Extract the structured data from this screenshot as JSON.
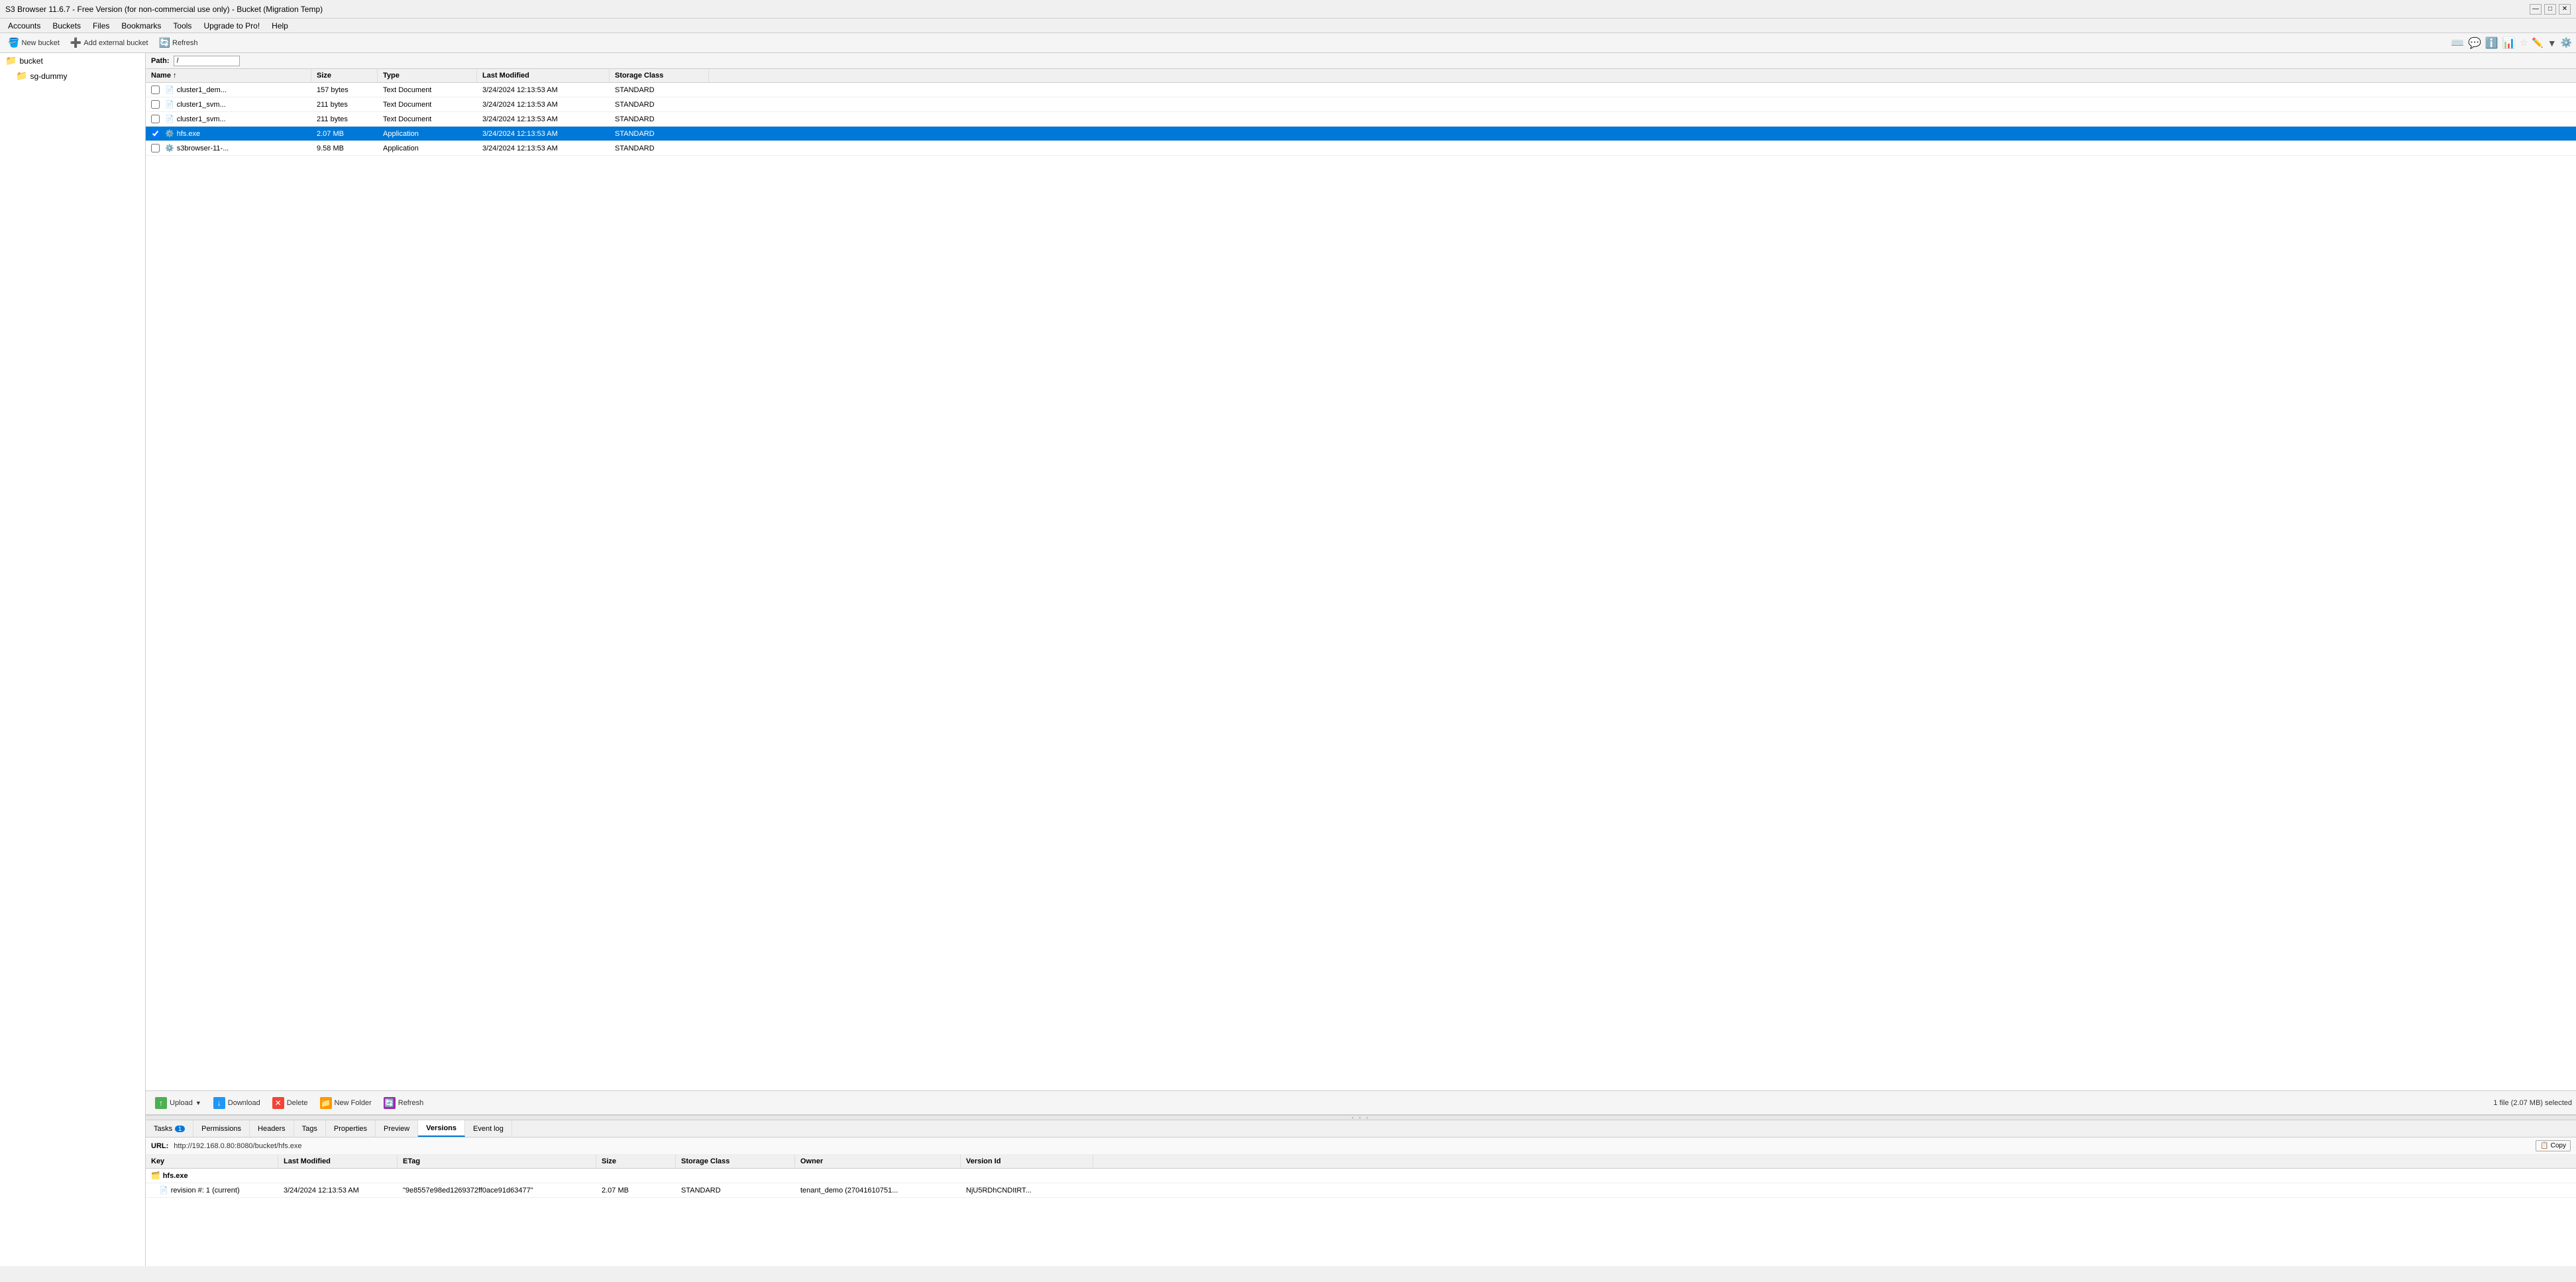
{
  "window": {
    "title": "S3 Browser 11.6.7 - Free Version (for non-commercial use only) - Bucket (Migration Temp)"
  },
  "title_bar": {
    "title": "S3 Browser 11.6.7 - Free Version (for non-commercial use only) - Bucket (Migration Temp)",
    "minimize": "—",
    "maximize": "□",
    "close": "✕"
  },
  "menu": {
    "items": [
      "Accounts",
      "Buckets",
      "Files",
      "Bookmarks",
      "Tools",
      "Upgrade to Pro!",
      "Help"
    ]
  },
  "toolbar": {
    "new_bucket": "New bucket",
    "add_external": "Add external bucket",
    "refresh": "Refresh"
  },
  "path_bar": {
    "label": "Path:",
    "value": "/"
  },
  "left_panel": {
    "items": [
      {
        "name": "bucket",
        "type": "folder",
        "indent": 0
      },
      {
        "name": "sg-dummy",
        "type": "folder",
        "indent": 1
      }
    ]
  },
  "file_list": {
    "columns": [
      "Name",
      "Size",
      "Type",
      "Last Modified",
      "Storage Class"
    ],
    "rows": [
      {
        "name": "cluster1_dem...",
        "size": "157 bytes",
        "type": "Text Document",
        "modified": "3/24/2024 12:13:53 AM",
        "storage": "STANDARD",
        "selected": false,
        "icon": "📄"
      },
      {
        "name": "cluster1_svm...",
        "size": "211 bytes",
        "type": "Text Document",
        "modified": "3/24/2024 12:13:53 AM",
        "storage": "STANDARD",
        "selected": false,
        "icon": "📄"
      },
      {
        "name": "cluster1_svm...",
        "size": "211 bytes",
        "type": "Text Document",
        "modified": "3/24/2024 12:13:53 AM",
        "storage": "STANDARD",
        "selected": false,
        "icon": "📄"
      },
      {
        "name": "hfs.exe",
        "size": "2.07 MB",
        "type": "Application",
        "modified": "3/24/2024 12:13:53 AM",
        "storage": "STANDARD",
        "selected": true,
        "icon": "⚙️"
      },
      {
        "name": "s3browser-11-...",
        "size": "9.58 MB",
        "type": "Application",
        "modified": "3/24/2024 12:13:53 AM",
        "storage": "STANDARD",
        "selected": false,
        "icon": "⚙️"
      }
    ],
    "status": "1 file (2.07 MB) selected"
  },
  "action_toolbar": {
    "upload": "Upload",
    "download": "Download",
    "delete": "Delete",
    "new_folder": "New Folder",
    "refresh": "Refresh"
  },
  "tabs": {
    "items": [
      {
        "label": "Tasks",
        "badge": "1",
        "active": false
      },
      {
        "label": "Permissions",
        "badge": null,
        "active": false
      },
      {
        "label": "Headers",
        "badge": null,
        "active": false
      },
      {
        "label": "Tags",
        "badge": null,
        "active": false
      },
      {
        "label": "Properties",
        "badge": null,
        "active": false
      },
      {
        "label": "Preview",
        "badge": null,
        "active": false
      },
      {
        "label": "Versions",
        "badge": null,
        "active": true
      },
      {
        "label": "Event log",
        "badge": null,
        "active": false
      }
    ]
  },
  "url_bar": {
    "label": "URL:",
    "value": "http://192.168.0.80:8080/bucket/hfs.exe",
    "copy_label": "Copy"
  },
  "versions": {
    "columns": [
      "Key",
      "Last Modified",
      "ETag",
      "Size",
      "Storage Class",
      "Owner",
      "Version Id"
    ],
    "rows": [
      {
        "key": "hfs.exe",
        "is_parent": true,
        "modified": "",
        "etag": "",
        "size": "",
        "storage": "",
        "owner": "",
        "version_id": "",
        "icon": "🗂️"
      },
      {
        "key": "revision #: 1 (current)",
        "is_parent": false,
        "modified": "3/24/2024 12:13:53 AM",
        "etag": "\"9e8557e98ed1269372ff0ace91d63477\"",
        "size": "2.07 MB",
        "storage": "STANDARD",
        "owner": "tenant_demo (27041610751...",
        "version_id": "NjU5RDhCNDItRT...",
        "icon": "📄"
      }
    ]
  },
  "sys_toolbar": {
    "icons": [
      "⌨️",
      "💬",
      "ℹ️",
      "📊"
    ]
  },
  "colors": {
    "selected_row_bg": "#0078d7",
    "selected_row_text": "#ffffff",
    "header_bg": "#f0f0f0",
    "accent": "#0078d7"
  }
}
